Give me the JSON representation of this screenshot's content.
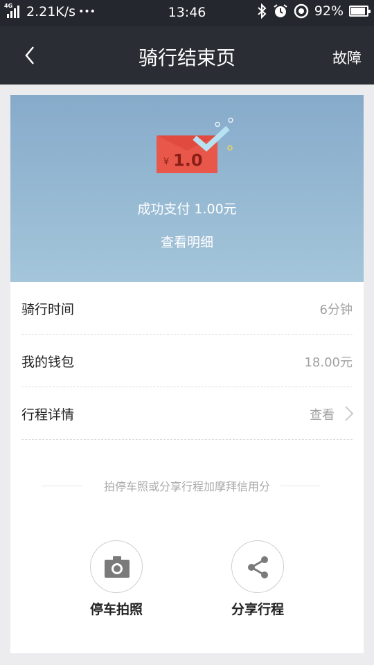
{
  "status_bar": {
    "network": "4G",
    "speed": "2.21K/s",
    "dots": "•••",
    "time": "13:46",
    "battery_text": "92%",
    "battery_level": 0.92
  },
  "nav": {
    "title": "骑行结束页",
    "action": "故障"
  },
  "hero": {
    "envelope_currency": "¥",
    "envelope_amount": "1.0",
    "payment_text": "成功支付 1.00元",
    "detail_link": "查看明细"
  },
  "rows": [
    {
      "label": "骑行时间",
      "value": "6分钟"
    },
    {
      "label": "我的钱包",
      "value": "18.00元"
    },
    {
      "label": "行程详情",
      "value": "查看"
    }
  ],
  "bottom": {
    "hint": "拍停车照或分享行程加摩拜信用分",
    "photo_label": "停车拍照",
    "share_label": "分享行程"
  },
  "colors": {
    "nav_bg": "#2a2d34",
    "hero_top": "#86abca",
    "envelope_red": "#e9574b",
    "check_blue": "#a8d8ec"
  }
}
